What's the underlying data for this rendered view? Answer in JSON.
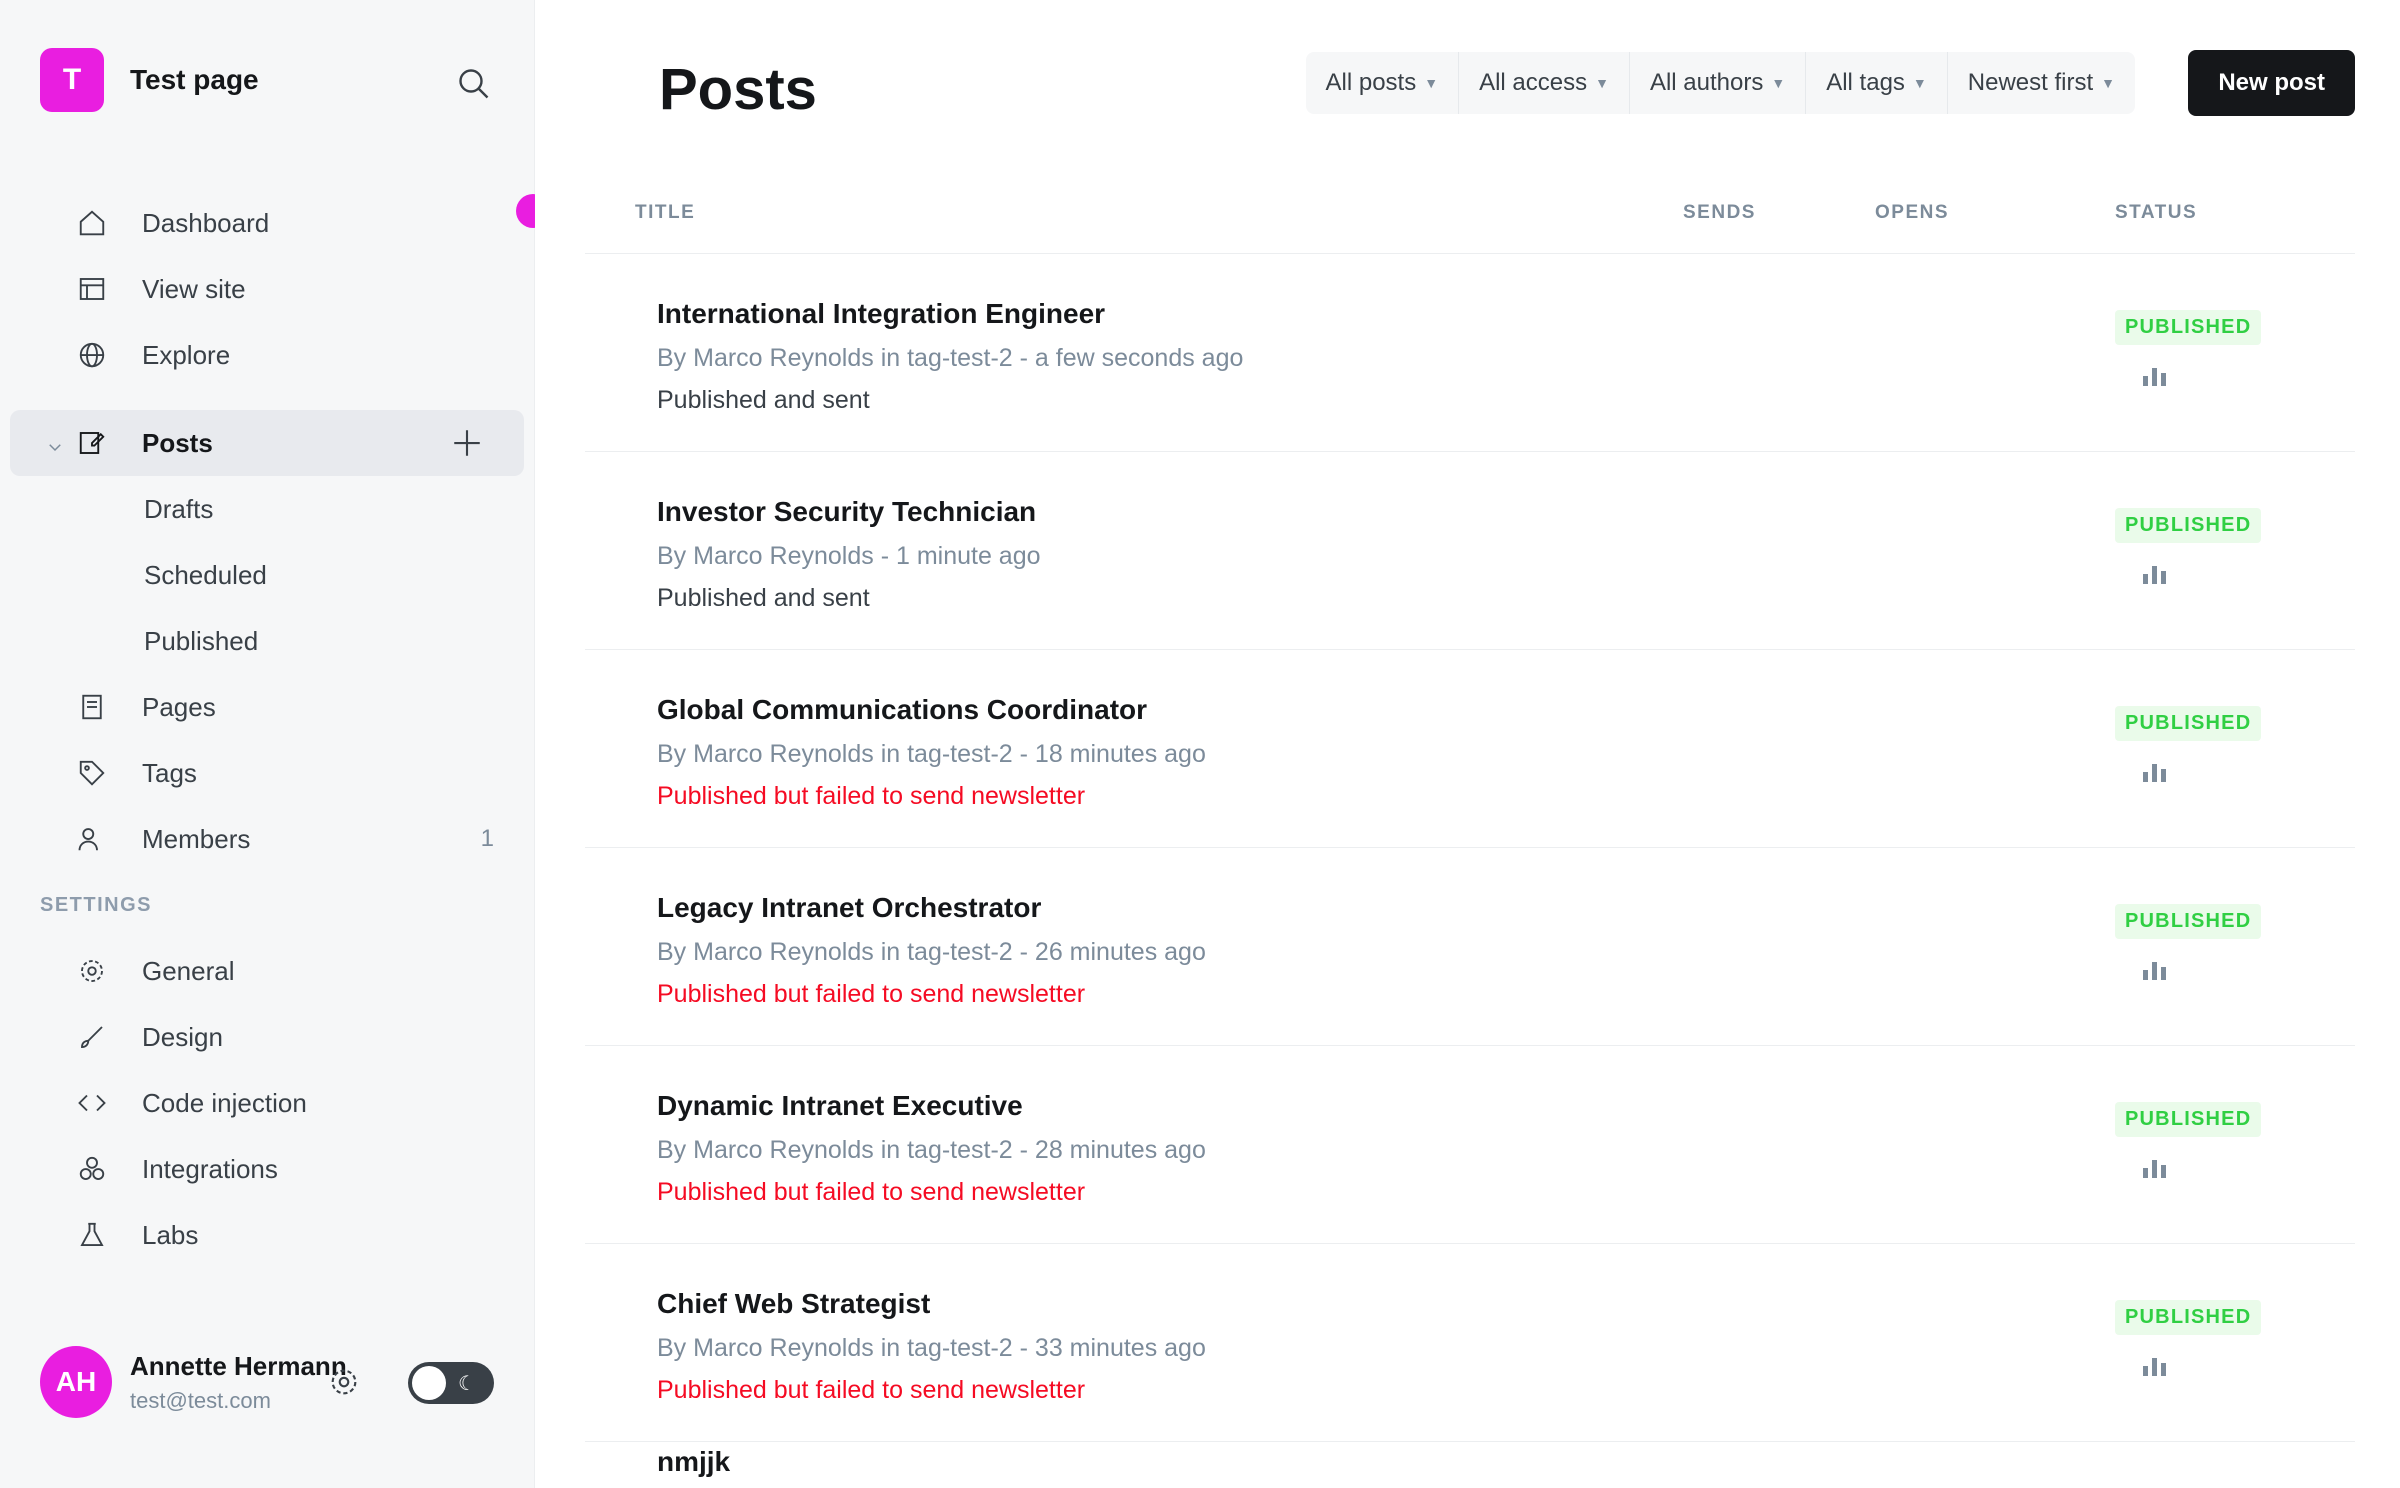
{
  "sidebar": {
    "site_title": "Test page",
    "logo_letter": "T",
    "nav_top": [
      {
        "label": "Dashboard",
        "icon": "home-icon"
      },
      {
        "label": "View site",
        "icon": "browser-icon"
      },
      {
        "label": "Explore",
        "icon": "globe-icon"
      }
    ],
    "posts": {
      "label": "Posts",
      "sub": [
        {
          "label": "Drafts"
        },
        {
          "label": "Scheduled"
        },
        {
          "label": "Published"
        }
      ]
    },
    "nav_mid": [
      {
        "label": "Pages",
        "icon": "page-icon"
      },
      {
        "label": "Tags",
        "icon": "tag-icon"
      },
      {
        "label": "Members",
        "icon": "members-icon",
        "count": "1"
      }
    ],
    "settings_label": "SETTINGS",
    "settings_items": [
      {
        "label": "General",
        "icon": "gear-icon"
      },
      {
        "label": "Design",
        "icon": "brush-icon"
      },
      {
        "label": "Code injection",
        "icon": "code-icon"
      },
      {
        "label": "Integrations",
        "icon": "integrations-icon"
      },
      {
        "label": "Labs",
        "icon": "flask-icon"
      }
    ],
    "user": {
      "name": "Annette Hermann",
      "email": "test@test.com",
      "initials": "AH"
    }
  },
  "main": {
    "title": "Posts",
    "filters": [
      "All posts",
      "All access",
      "All authors",
      "All tags",
      "Newest first"
    ],
    "new_post_label": "New post",
    "columns": {
      "title": "TITLE",
      "sends": "SENDS",
      "opens": "OPENS",
      "status": "STATUS"
    },
    "posts": [
      {
        "title": "International Integration Engineer",
        "meta": "By Marco Reynolds in tag-test-2 - a few seconds ago",
        "note": "Published and sent",
        "warn": false,
        "status": "PUBLISHED"
      },
      {
        "title": "Investor Security Technician",
        "meta": "By Marco Reynolds - 1 minute ago",
        "note": "Published and sent",
        "warn": false,
        "status": "PUBLISHED"
      },
      {
        "title": "Global Communications Coordinator",
        "meta": "By Marco Reynolds in tag-test-2 - 18 minutes ago",
        "note": "Published but failed to send newsletter",
        "warn": true,
        "status": "PUBLISHED"
      },
      {
        "title": "Legacy Intranet Orchestrator",
        "meta": "By Marco Reynolds in tag-test-2 - 26 minutes ago",
        "note": "Published but failed to send newsletter",
        "warn": true,
        "status": "PUBLISHED"
      },
      {
        "title": "Dynamic Intranet Executive",
        "meta": "By Marco Reynolds in tag-test-2 - 28 minutes ago",
        "note": "Published but failed to send newsletter",
        "warn": true,
        "status": "PUBLISHED"
      },
      {
        "title": "Chief Web Strategist",
        "meta": "By Marco Reynolds in tag-test-2 - 33 minutes ago",
        "note": "Published but failed to send newsletter",
        "warn": true,
        "status": "PUBLISHED"
      }
    ],
    "last_row_title": "nmjjk"
  },
  "colors": {
    "accent": "#e91ee0",
    "published": "#30cf43",
    "warn": "#f50b23"
  }
}
